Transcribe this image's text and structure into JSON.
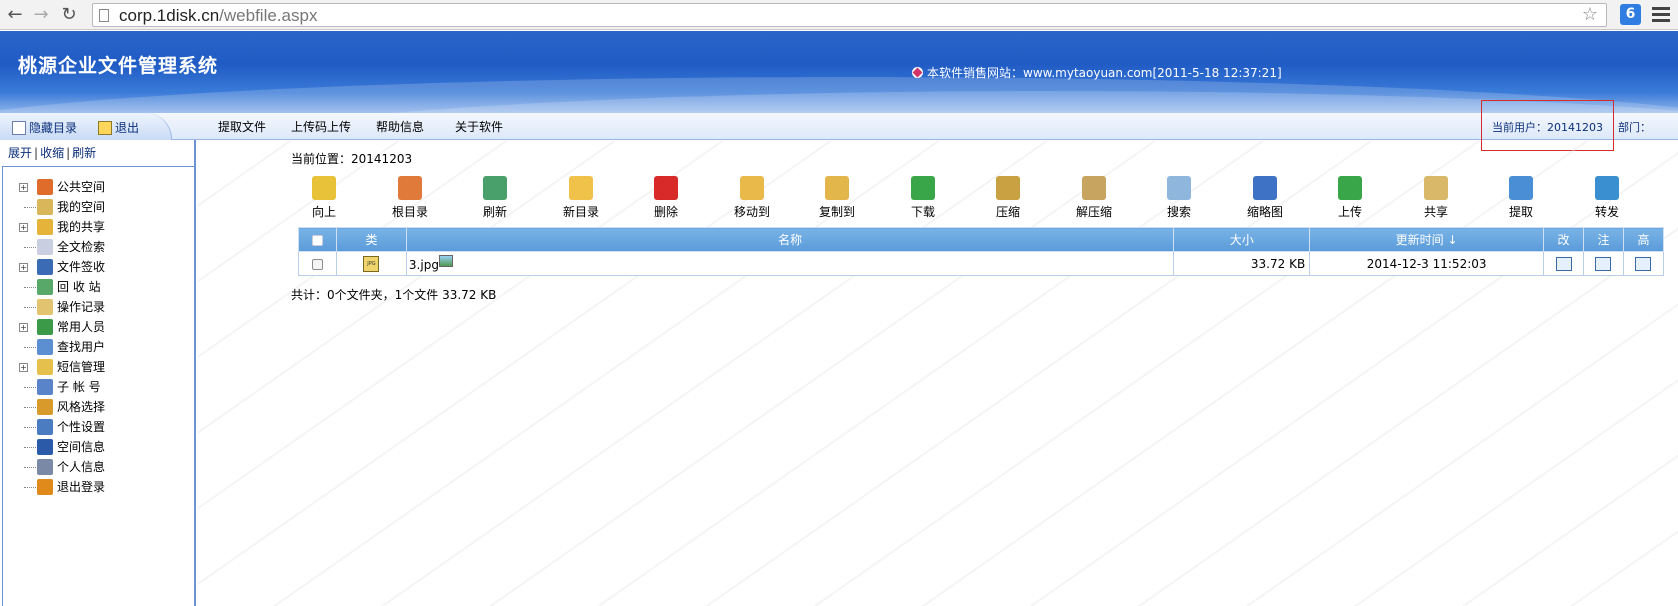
{
  "browser": {
    "url_host": "corp.1disk.cn",
    "url_path": "/webfile.aspx"
  },
  "header": {
    "title": "桃源企业文件管理系统",
    "sales_info": "本软件销售网站：www.mytaoyuan.com[2011-5-18 12:37:21]"
  },
  "topbar": {
    "hide_dir": "隐藏目录",
    "logout": "退出",
    "menus": [
      "提取文件",
      "上传码上传",
      "帮助信息",
      "关于软件"
    ],
    "current_user": "当前用户：20141203",
    "department": "部门："
  },
  "sidebar": {
    "expand": "展开",
    "collapse": "收缩",
    "refresh": "刷新",
    "items": [
      {
        "label": "公共空间",
        "icon": "public-space-icon",
        "color": "#e06c2c",
        "expandable": true
      },
      {
        "label": "我的空间",
        "icon": "my-space-icon",
        "color": "#d9b65a",
        "expandable": false
      },
      {
        "label": "我的共享",
        "icon": "my-share-icon",
        "color": "#e5b23a",
        "expandable": true
      },
      {
        "label": "全文检索",
        "icon": "fulltext-search-icon",
        "color": "#c9cfe0",
        "expandable": false
      },
      {
        "label": "文件签收",
        "icon": "file-signoff-icon",
        "color": "#3c6bb5",
        "expandable": true
      },
      {
        "label": "回 收 站",
        "icon": "recycle-bin-icon",
        "color": "#58a86a",
        "expandable": false
      },
      {
        "label": "操作记录",
        "icon": "operation-log-icon",
        "color": "#e2c470",
        "expandable": false
      },
      {
        "label": "常用人员",
        "icon": "contacts-icon",
        "color": "#3a9a48",
        "expandable": true
      },
      {
        "label": "查找用户",
        "icon": "find-user-icon",
        "color": "#5b8fd1",
        "expandable": false
      },
      {
        "label": "短信管理",
        "icon": "sms-icon",
        "color": "#e6c04d",
        "expandable": true
      },
      {
        "label": "子 帐 号",
        "icon": "sub-account-icon",
        "color": "#5a84c9",
        "expandable": false
      },
      {
        "label": "风格选择",
        "icon": "style-icon",
        "color": "#d79a2b",
        "expandable": false
      },
      {
        "label": "个性设置",
        "icon": "settings-icon",
        "color": "#4b7bc1",
        "expandable": false
      },
      {
        "label": "空间信息",
        "icon": "space-info-icon",
        "color": "#2a5aa8",
        "expandable": false
      },
      {
        "label": "个人信息",
        "icon": "personal-info-icon",
        "color": "#7a8aa6",
        "expandable": false
      },
      {
        "label": "退出登录",
        "icon": "logout-icon",
        "color": "#e08a1c",
        "expandable": false
      }
    ]
  },
  "location": {
    "label": "当前位置：",
    "value": "20141203"
  },
  "toolbar": [
    {
      "label": "向上",
      "icon": "up-icon",
      "color": "#e8c33a"
    },
    {
      "label": "根目录",
      "icon": "root-dir-icon",
      "color": "#e07a3b"
    },
    {
      "label": "刷新",
      "icon": "refresh-icon",
      "color": "#4aa06a"
    },
    {
      "label": "新目录",
      "icon": "new-folder-icon",
      "color": "#f0c24a"
    },
    {
      "label": "删除",
      "icon": "delete-icon",
      "color": "#d92a2a"
    },
    {
      "label": "移动到",
      "icon": "move-to-icon",
      "color": "#e9b94a"
    },
    {
      "label": "复制到",
      "icon": "copy-to-icon",
      "color": "#e3b64c"
    },
    {
      "label": "下载",
      "icon": "download-icon",
      "color": "#3aa64a"
    },
    {
      "label": "压缩",
      "icon": "compress-icon",
      "color": "#c9a042"
    },
    {
      "label": "解压缩",
      "icon": "decompress-icon",
      "color": "#c7a560"
    },
    {
      "label": "搜索",
      "icon": "search-icon",
      "color": "#8fb7dd"
    },
    {
      "label": "缩略图",
      "icon": "thumbnail-icon",
      "color": "#3d72c4"
    },
    {
      "label": "上传",
      "icon": "upload-icon",
      "color": "#3aa64a"
    },
    {
      "label": "共享",
      "icon": "share-icon",
      "color": "#d9b86a"
    },
    {
      "label": "提取",
      "icon": "extract-icon",
      "color": "#4a8fd6"
    },
    {
      "label": "转发",
      "icon": "forward-icon",
      "color": "#3a8fd0"
    }
  ],
  "table": {
    "headers": {
      "type": "类",
      "name": "名称",
      "size": "大小",
      "modified": "更新时间 ↓",
      "rename": "改",
      "note": "注",
      "advanced": "高"
    },
    "rows": [
      {
        "name": "3.jpg",
        "size": "33.72 KB",
        "modified": "2014-12-3 11:52:03"
      }
    ]
  },
  "summary": "共计：0个文件夹，1个文件 33.72 KB"
}
